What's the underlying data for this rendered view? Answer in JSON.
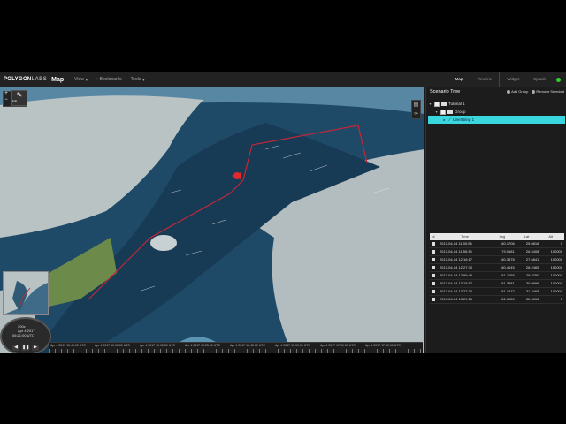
{
  "app": {
    "logo": "POLYGON",
    "logo_sub": "LABS",
    "title": "Map",
    "menus": [
      {
        "label": "View"
      },
      {
        "label": "Bookmarks"
      },
      {
        "label": "Tools"
      }
    ],
    "tabs": [
      {
        "label": "Map"
      },
      {
        "label": "Timeline"
      },
      {
        "label": "Widget"
      },
      {
        "label": "Splash"
      }
    ]
  },
  "map": {
    "zoom_in": "+",
    "zoom_out": "−",
    "edit_label": "Edit"
  },
  "clock": {
    "speed": "300x",
    "date": "Apr 4 2017",
    "time": "06:21:00 UTC"
  },
  "timeline": {
    "handle_label": "Minutes",
    "labels": [
      "Apr 4 2017 15:40:00 UTC",
      "Apr 4 2017 10:00:00 UTC",
      "Apr 4 2017 10:05:00 UTC",
      "Apr 4 2017 10:25:00 UTC",
      "Apr 4 2017 16:45:00 UTC",
      "Apr 4 2017 17:00:00 UTC",
      "Apr 4 2017 17:10:00 UTC",
      "Apr 4 2017 17:30:00 UTC"
    ]
  },
  "panel": {
    "title": "Scenario Tree",
    "add_group": "Add Group",
    "remove_selected": "Remove Selected",
    "tree": [
      {
        "label": "Tutorial 1"
      },
      {
        "label": "Group"
      },
      {
        "label": "LineString 1"
      }
    ],
    "table": {
      "headers": [
        "#",
        "Time",
        "Lng",
        "Lat",
        "Alt"
      ],
      "rows": [
        [
          "2017-04-04 11:00:56",
          "-80.1706",
          "25.0816",
          "0"
        ],
        [
          "2017-04-04 11:55:34",
          "-79.0181",
          "26.5408",
          "100000"
        ],
        [
          "2017-04-04 12:16:17",
          "-80.3378",
          "27.6841",
          "100000"
        ],
        [
          "2017-04-04 12:27:30",
          "-80.4045",
          "28.2465",
          "150000"
        ],
        [
          "2017-04-04 12:59:49",
          "-81.1055",
          "29.8750",
          "100000"
        ],
        [
          "2017-04-04 13:15:57",
          "-81.3381",
          "30.0999",
          "100000"
        ],
        [
          "2017-04-04 13:27:30",
          "-81.1872",
          "31.3468",
          "100000"
        ],
        [
          "2017-04-04 13:29:56",
          "-81.0089",
          "32.0006",
          "0"
        ]
      ]
    }
  },
  "colors": {
    "accent": "#39d7dd",
    "route": "#c0283a",
    "ocean": "#224b6a",
    "land": "#b7c1c2",
    "status": "#33cc33"
  }
}
